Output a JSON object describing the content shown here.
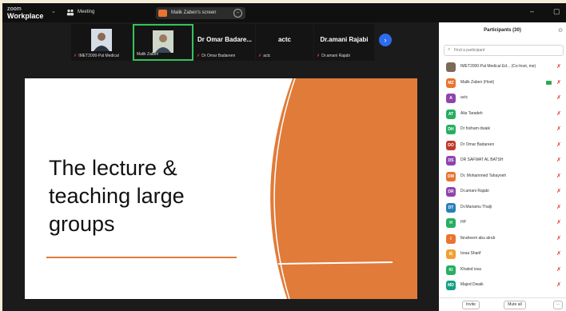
{
  "app": {
    "logo_line1": "zoom",
    "logo_line2": "Workplace",
    "meeting_label": "Meeting"
  },
  "share_banner": {
    "label": "Malik Zaben's screen"
  },
  "window_controls": {
    "minimize": "–",
    "restore": "▢"
  },
  "video_strip": [
    {
      "name": "IMET2000-Pal Medical",
      "type": "video"
    },
    {
      "name": "Malik Zaben",
      "type": "video",
      "active": true
    },
    {
      "big": "Dr Omar Badare...",
      "name": "Dr Omar Badareen",
      "type": "name"
    },
    {
      "big": "actc",
      "name": "actc",
      "type": "name"
    },
    {
      "big": "Dr.amani Rajabi",
      "name": "Dr.amani Rajabi",
      "type": "name"
    }
  ],
  "slide": {
    "title": "The lecture &\nteaching large\ngroups",
    "accent_color": "#e07b39"
  },
  "participants": {
    "title": "Participants (30)",
    "search_placeholder": "Find a participant",
    "list": [
      {
        "initials": "",
        "name": "IMET2000-Pal Medical Ed... (Co-host, me)",
        "color": "#7a6a5a",
        "camera": false
      },
      {
        "initials": "MZ",
        "name": "Malik Zaben (Host)",
        "color": "#e8742f",
        "camera": true
      },
      {
        "initials": "A",
        "name": "actc",
        "color": "#8e44ad",
        "camera": false
      },
      {
        "initials": "AT",
        "name": "Alia Taradeh",
        "color": "#27ae60",
        "camera": false
      },
      {
        "initials": "DH",
        "name": "Dr hisham dwaik",
        "color": "#27ae60",
        "camera": false
      },
      {
        "initials": "DO",
        "name": "Dr Omar Badareen",
        "color": "#c0392b",
        "camera": false
      },
      {
        "initials": "DS",
        "name": "DR SAFWAT AL BATSH",
        "color": "#8e44ad",
        "camera": false
      },
      {
        "initials": "DM",
        "name": "Dr. Mohammed Tahayneh",
        "color": "#e8742f",
        "camera": false
      },
      {
        "initials": "DR",
        "name": "Dr.amani Rajabi",
        "color": "#8e44ad",
        "camera": false
      },
      {
        "initials": "DT",
        "name": "Dr.Mariamu Thalji",
        "color": "#2980b9",
        "camera": false
      },
      {
        "initials": "H",
        "name": "HP",
        "color": "#27ae60",
        "camera": false
      },
      {
        "initials": "I",
        "name": "Ibraheem abu alrub",
        "color": "#e8742f",
        "camera": false
      },
      {
        "initials": "IS",
        "name": "Israa Sharif",
        "color": "#f0a030",
        "camera": false
      },
      {
        "initials": "KI",
        "name": "Khaled issa",
        "color": "#27ae60",
        "camera": false
      },
      {
        "initials": "MD",
        "name": "Majed Dwaik",
        "color": "#16a085",
        "camera": false
      }
    ],
    "invite_label": "Invite",
    "mute_all_label": "Mute all",
    "more_label": "···"
  }
}
